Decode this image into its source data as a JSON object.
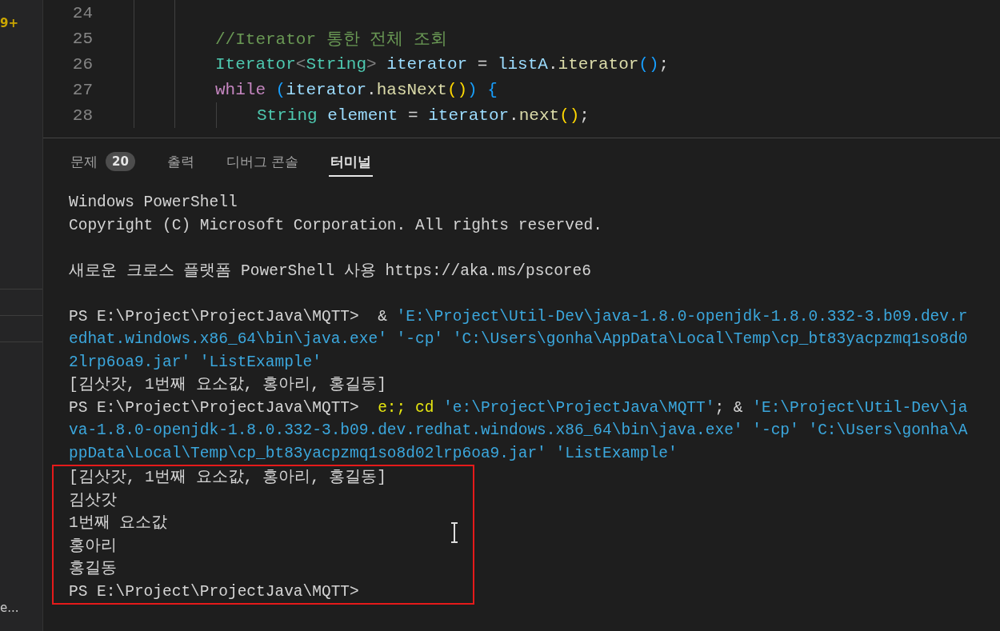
{
  "sidebar": {
    "badge": "9+",
    "truncated_label": "e..."
  },
  "editor": {
    "lines": [
      {
        "number": "24"
      },
      {
        "number": "25",
        "tokens": [
          {
            "text": "//Iterator 통한 전체 조회",
            "kind": "comment"
          }
        ]
      },
      {
        "number": "26",
        "tokens": [
          {
            "text": "Iterator",
            "kind": "type"
          },
          {
            "text": "<",
            "kind": "punct"
          },
          {
            "text": "String",
            "kind": "type"
          },
          {
            "text": ">",
            "kind": "punct"
          },
          {
            "text": " iterator",
            "kind": "variable"
          },
          {
            "text": " = ",
            "kind": "plain"
          },
          {
            "text": "listA",
            "kind": "variable"
          },
          {
            "text": ".",
            "kind": "plain"
          },
          {
            "text": "iterator",
            "kind": "method"
          },
          {
            "text": "()",
            "kind": "bracket3"
          },
          {
            "text": ";",
            "kind": "plain"
          }
        ]
      },
      {
        "number": "27",
        "tokens": [
          {
            "text": "while",
            "kind": "keyword"
          },
          {
            "text": " (",
            "kind": "bracket3"
          },
          {
            "text": "iterator",
            "kind": "variable"
          },
          {
            "text": ".",
            "kind": "plain"
          },
          {
            "text": "hasNext",
            "kind": "method"
          },
          {
            "text": "()",
            "kind": "bracket1"
          },
          {
            "text": ")",
            "kind": "bracket3"
          },
          {
            "text": " {",
            "kind": "bracket3"
          }
        ],
        "children": [
          {
            "number": "28",
            "tokens": [
              {
                "text": "String",
                "kind": "type"
              },
              {
                "text": " element",
                "kind": "variable"
              },
              {
                "text": " = ",
                "kind": "plain"
              },
              {
                "text": "iterator",
                "kind": "variable"
              },
              {
                "text": ".",
                "kind": "plain"
              },
              {
                "text": "next",
                "kind": "method"
              },
              {
                "text": "()",
                "kind": "bracket1"
              },
              {
                "text": ";",
                "kind": "plain"
              }
            ]
          }
        ]
      }
    ]
  },
  "panel": {
    "tabs": [
      {
        "label": "문제",
        "badge": "20",
        "selected": false
      },
      {
        "label": "출력",
        "selected": false
      },
      {
        "label": "디버그 콘솔",
        "selected": false
      },
      {
        "label": "터미널",
        "selected": true
      }
    ],
    "terminal": {
      "blocks": [
        {
          "lines": [
            [
              {
                "text": "Windows PowerShell",
                "kind": "plain"
              }
            ],
            [
              {
                "text": "Copyright (C) Microsoft Corporation. All rights reserved.",
                "kind": "plain"
              }
            ]
          ]
        },
        {
          "lines": [
            [
              {
                "text": "새로운 크로스 플랫폼 PowerShell 사용 https://aka.ms/pscore6",
                "kind": "plain"
              }
            ]
          ]
        },
        {
          "lines": [
            [
              {
                "text": "PS E:\\Project\\ProjectJava\\MQTT>  & ",
                "kind": "plain"
              },
              {
                "text": "'E:\\Project\\Util-Dev\\java-1.8.0-openjdk-1.8.0.332-3.b09.dev.r",
                "kind": "string"
              }
            ],
            [
              {
                "text": "edhat.windows.x86_64\\bin\\java.exe' '-cp' 'C:\\Users\\gonha\\AppData\\Local\\Temp\\cp_bt83yacpzmq1so8d0",
                "kind": "string"
              }
            ],
            [
              {
                "text": "2lrp6oa9.jar' 'ListExample'",
                "kind": "string"
              }
            ],
            [
              {
                "text": "[김삿갓, 1번째 요소값, 홍아리, 홍길동]",
                "kind": "plain"
              }
            ],
            [
              {
                "text": "PS E:\\Project\\ProjectJava\\MQTT>  ",
                "kind": "plain"
              },
              {
                "text": "e:; cd",
                "kind": "command"
              },
              {
                "text": " 'e:\\Project\\ProjectJava\\MQTT'",
                "kind": "string"
              },
              {
                "text": "; & ",
                "kind": "plain"
              },
              {
                "text": "'E:\\Project\\Util-Dev\\ja",
                "kind": "string"
              }
            ],
            [
              {
                "text": "va-1.8.0-openjdk-1.8.0.332-3.b09.dev.redhat.windows.x86_64\\bin\\java.exe' '-cp' 'C:\\Users\\gonha\\A",
                "kind": "string"
              }
            ],
            [
              {
                "text": "ppData\\Local\\Temp\\cp_bt83yacpzmq1so8d02lrp6oa9.jar' 'ListExample'",
                "kind": "string"
              }
            ]
          ]
        }
      ],
      "highlighted": {
        "lines": [
          [
            {
              "text": "[김삿갓, 1번째 요소값, 홍아리, 홍길동]",
              "kind": "plain"
            }
          ],
          [
            {
              "text": "김삿갓",
              "kind": "plain"
            }
          ],
          [
            {
              "text": "1번째 요소값",
              "kind": "plain"
            }
          ],
          [
            {
              "text": "홍아리",
              "kind": "plain"
            }
          ],
          [
            {
              "text": "홍길동",
              "kind": "plain"
            }
          ],
          [
            {
              "text": "PS E:\\Project\\ProjectJava\\MQTT>",
              "kind": "plain"
            }
          ]
        ]
      }
    }
  }
}
